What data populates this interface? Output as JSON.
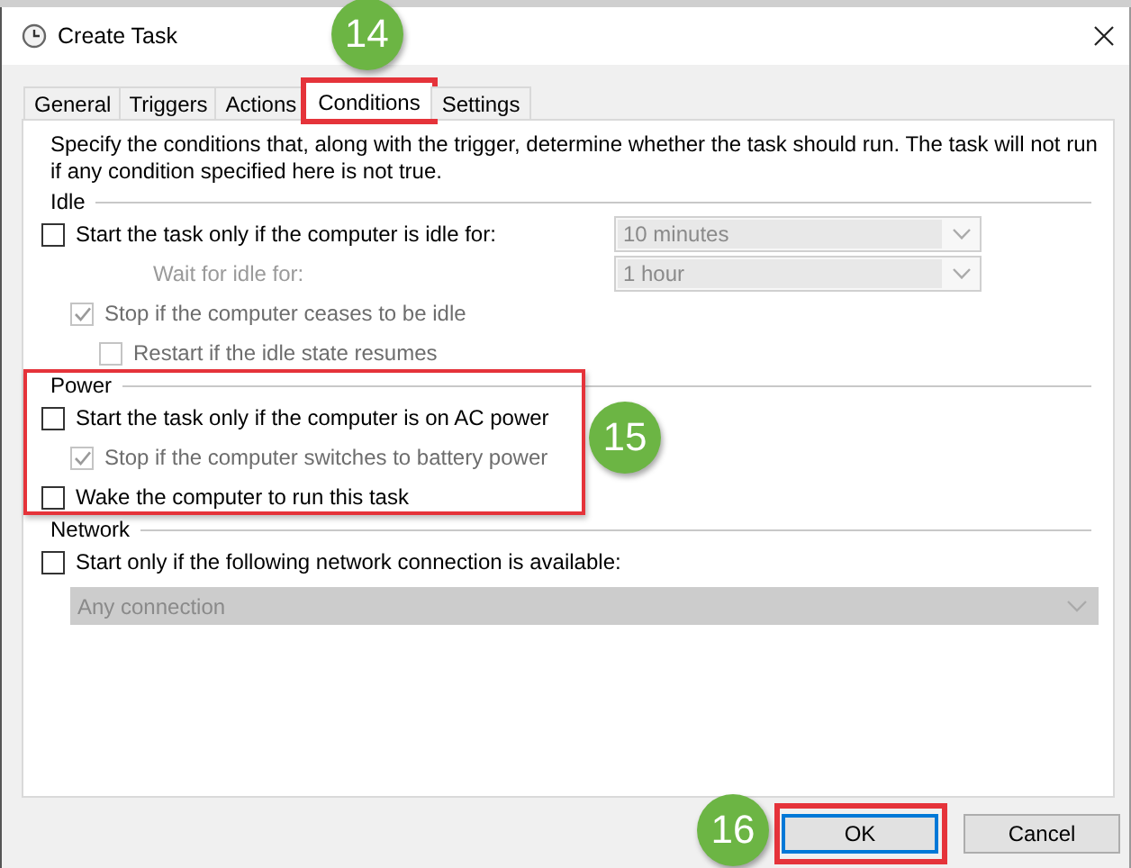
{
  "window": {
    "title": "Create Task"
  },
  "tabs": [
    {
      "label": "General",
      "selected": false,
      "highlighted": false
    },
    {
      "label": "Triggers",
      "selected": false,
      "highlighted": false
    },
    {
      "label": "Actions",
      "selected": false,
      "highlighted": false
    },
    {
      "label": "Conditions",
      "selected": true,
      "highlighted": true,
      "badge": "14"
    },
    {
      "label": "Settings",
      "selected": false,
      "highlighted": false
    }
  ],
  "description": "Specify the conditions that, along with the trigger, determine whether the task should run.  The task will not run  if any condition specified here is not true.",
  "sections": [
    {
      "title": "Idle",
      "highlighted": false,
      "rows": [
        {
          "kind": "checkbox",
          "label": "Start the task only if the computer is idle for:",
          "checked": false,
          "disabled": false,
          "dropdown": {
            "value": "10 minutes",
            "disabled": true
          },
          "children": [
            {
              "kind": "label",
              "label": "Wait for idle for:",
              "disabled": true,
              "dropdown": {
                "value": "1 hour",
                "disabled": true
              }
            },
            {
              "kind": "checkbox",
              "label": "Stop if the computer ceases to be idle",
              "checked": true,
              "disabled": true,
              "children": [
                {
                  "kind": "checkbox",
                  "label": "Restart if the idle state resumes",
                  "checked": false,
                  "disabled": true
                }
              ]
            }
          ]
        }
      ]
    },
    {
      "title": "Power",
      "highlighted": true,
      "badge": "15",
      "rows": [
        {
          "kind": "checkbox",
          "label": "Start the task only if the computer is on AC power",
          "checked": false,
          "disabled": false,
          "children": [
            {
              "kind": "checkbox",
              "label": "Stop if the computer switches to battery power",
              "checked": true,
              "disabled": true
            }
          ]
        },
        {
          "kind": "checkbox",
          "label": "Wake the computer to run this task",
          "checked": false,
          "disabled": false
        }
      ]
    },
    {
      "title": "Network",
      "highlighted": false,
      "rows": [
        {
          "kind": "checkbox",
          "label": "Start only if the following network connection is available:",
          "checked": false,
          "disabled": false
        },
        {
          "kind": "dropdown",
          "value": "Any connection",
          "disabled": true
        }
      ]
    }
  ],
  "buttons": [
    {
      "label": "OK",
      "focused": true,
      "highlighted": true,
      "badge": "16"
    },
    {
      "label": "Cancel",
      "focused": false,
      "highlighted": false
    }
  ]
}
